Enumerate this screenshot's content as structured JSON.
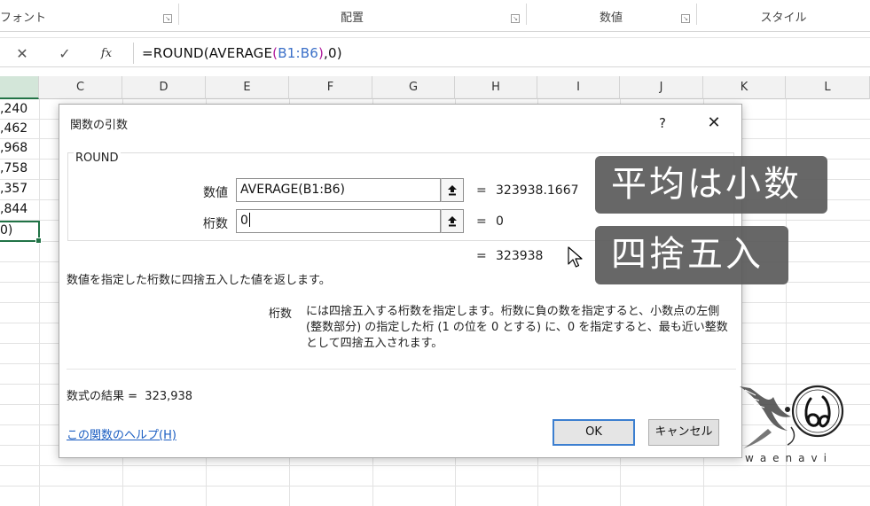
{
  "ribbon": {
    "groups": [
      {
        "label": "フォント"
      },
      {
        "label": "配置"
      },
      {
        "label": "数値"
      },
      {
        "label": "スタイル"
      }
    ],
    "launcher_glyph": "↘"
  },
  "formula_bar": {
    "cancel_glyph": "✕",
    "enter_glyph": "✓",
    "fx_label": "fx",
    "formula_parts": {
      "prefix": "=ROUND(AVERAGE",
      "open_paren": "(",
      "ref": "B1:B6",
      "close_paren": ")",
      "suffix": ",0)"
    }
  },
  "grid": {
    "column_headers": [
      "C",
      "D",
      "E",
      "F",
      "G",
      "H",
      "I",
      "J",
      "K",
      "L"
    ],
    "partial_column_b_values": [
      ",240",
      ",462",
      ",968",
      ",758",
      ",357",
      ",844",
      "0)"
    ]
  },
  "dialog": {
    "title": "関数の引数",
    "help_glyph": "?",
    "close_glyph": "✕",
    "function_name": "ROUND",
    "args": [
      {
        "label": "数値",
        "value": "AVERAGE(B1:B6)",
        "eval_eq": "=",
        "eval_value": "323938.1667"
      },
      {
        "label": "桁数",
        "value": "0",
        "eval_eq": "=",
        "eval_value": "0"
      }
    ],
    "result_eq": "=",
    "result_value": "323938",
    "function_description": "数値を指定した桁数に四捨五入した値を返します。",
    "arg_desc_label": "桁数",
    "arg_desc_text": "には四捨五入する桁数を指定します。桁数に負の数を指定すると、小数点の左側 (整数部分) の指定した桁 (1 の位を 0 とする) に、0 を指定すると、最も近い整数として四捨五入されます。",
    "formula_result_label": "数式の結果 =",
    "formula_result_value": "323,938",
    "help_link": "この関数のヘルプ(H)",
    "ok_label": "OK",
    "cancel_label": "キャンセル"
  },
  "captions": {
    "caption_1": "平均は小数",
    "caption_2": "四捨五入"
  },
  "logo": {
    "text": "waenavi"
  },
  "colors": {
    "excel_green": "#217346",
    "link_blue": "#1b5ec2",
    "ok_border": "#3c7fd0",
    "caption_bg": "#5a5a5a",
    "ref_blue": "#3a6fc8",
    "paren_purple": "#b01c9c"
  }
}
